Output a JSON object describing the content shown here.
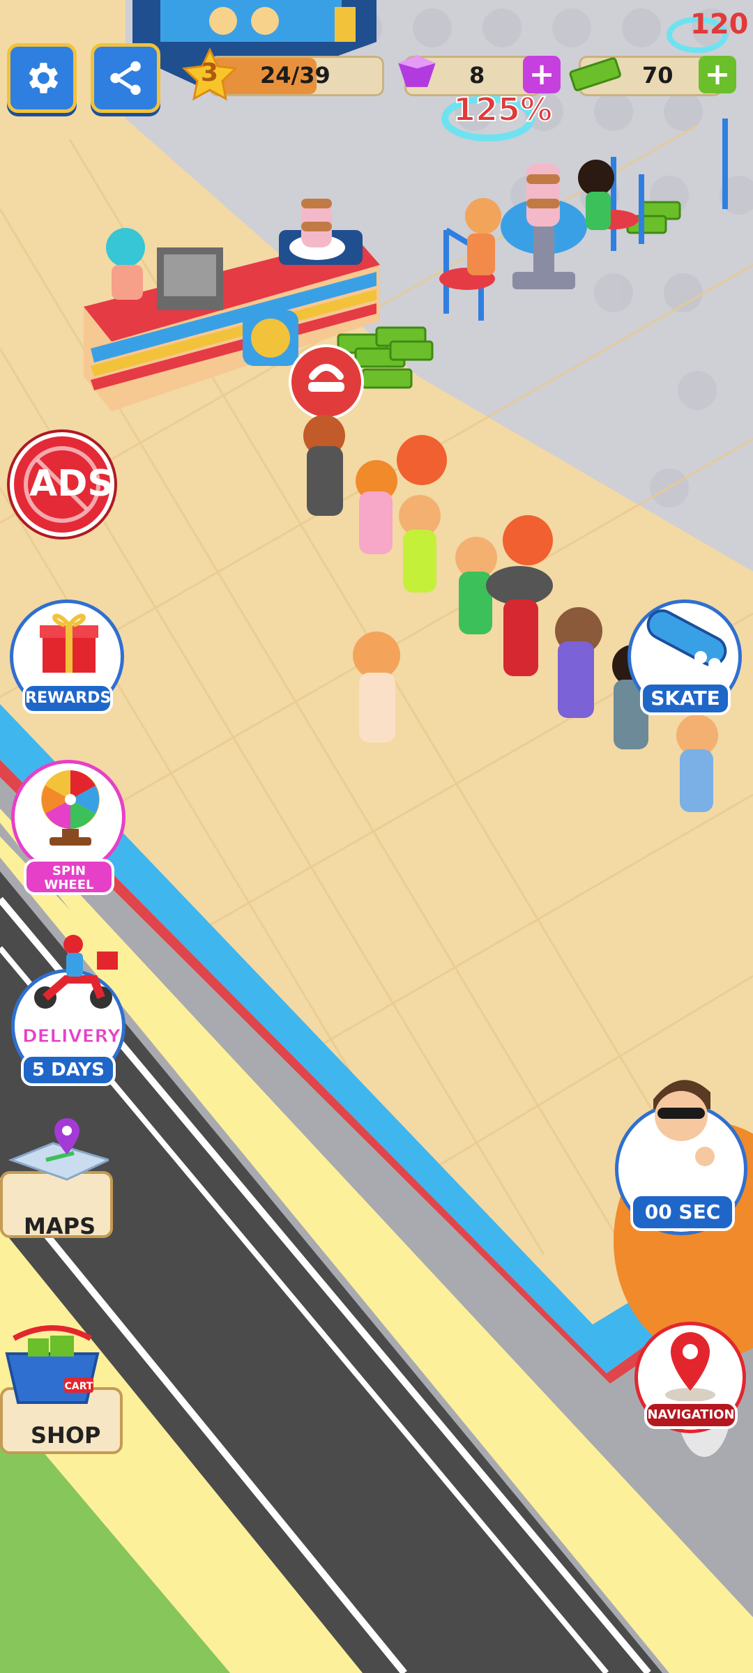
{
  "hud": {
    "level": "3",
    "xp_progress": "24/39",
    "xp_fraction": 0.615,
    "gems": "8",
    "cash": "70",
    "top_right_badge": "120"
  },
  "world": {
    "boost_percent": "125%"
  },
  "left_menu": {
    "ads_label": "ADS",
    "rewards_label": "REWARDS",
    "spin_wheel_label": "SPIN\nWHEEL",
    "delivery_title": "DELIVERY",
    "delivery_days": "5 DAYS",
    "maps_label": "MAPS",
    "shop_label": "SHOP",
    "cart_text": "CART"
  },
  "right_menu": {
    "skate_label": "SKATE",
    "timer_label": "00 SEC",
    "navigation_label": "NAVIGATION"
  },
  "colors": {
    "floor": "#f3d9a4",
    "wall_blue": "#3fb6ee",
    "wall_red": "#e0454b",
    "road": "#4b4b4b",
    "sidewalk_yellow": "#fdf09a",
    "grass": "#86c65a",
    "hud_blue": "#2f7fe0",
    "gem_purple": "#b23be0",
    "cash_green": "#6bbf2a"
  }
}
